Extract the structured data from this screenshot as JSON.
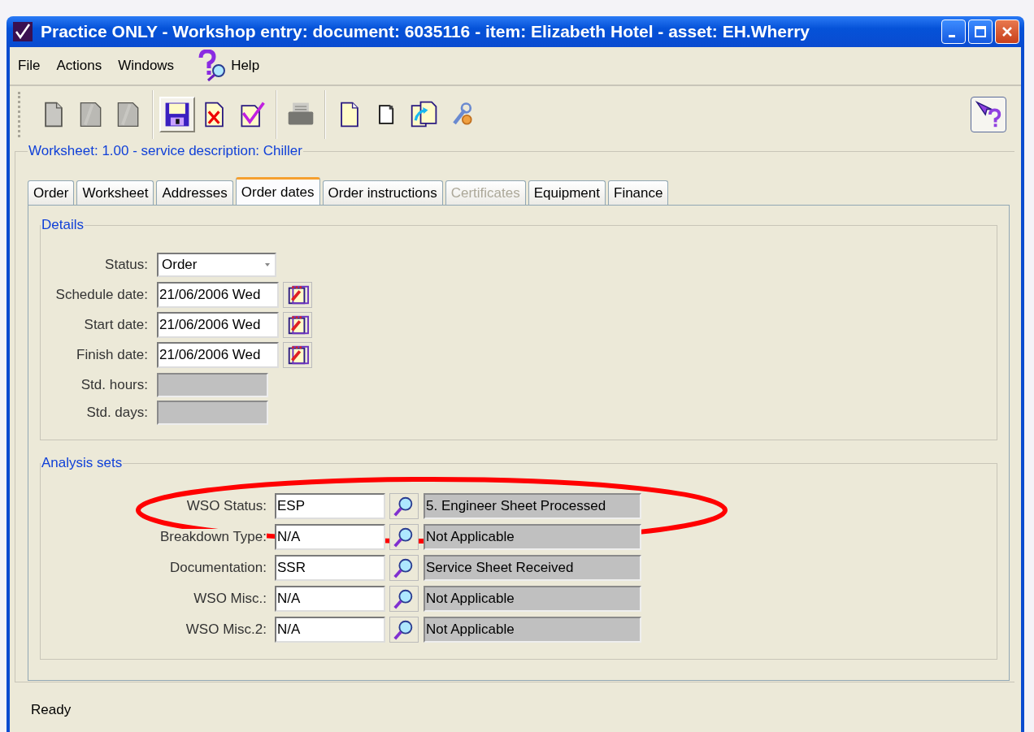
{
  "window": {
    "title": "Practice ONLY - Workshop entry: document: 6035116 - item: Elizabeth Hotel - asset: EH.Wherry"
  },
  "menu": [
    {
      "label": "File",
      "kind": "text"
    },
    {
      "label": "Actions",
      "kind": "text"
    },
    {
      "label": "Windows",
      "kind": "text"
    },
    {
      "label": "Help",
      "kind": "help"
    }
  ],
  "toolbar": [
    {
      "kind": "page",
      "disabled": true,
      "pressed": false
    },
    {
      "kind": "pages",
      "disabled": true,
      "pressed": false
    },
    {
      "kind": "pages",
      "disabled": true,
      "pressed": false
    },
    {
      "kind": "separator"
    },
    {
      "kind": "save",
      "disabled": false,
      "pressed": true
    },
    {
      "kind": "delete",
      "disabled": false,
      "pressed": false
    },
    {
      "kind": "approve",
      "disabled": false,
      "pressed": false
    },
    {
      "kind": "separator"
    },
    {
      "kind": "print",
      "disabled": true,
      "pressed": false
    },
    {
      "kind": "separator"
    },
    {
      "kind": "page",
      "disabled": false,
      "pressed": false
    },
    {
      "kind": "small-page",
      "disabled": false,
      "pressed": false
    },
    {
      "kind": "copy",
      "disabled": false,
      "pressed": false
    },
    {
      "kind": "tools",
      "disabled": false,
      "pressed": false
    }
  ],
  "worksheet_group": {
    "title": "Worksheet: 1.00 - service description: Chiller"
  },
  "tabs": [
    {
      "label": "Order",
      "selected": false,
      "disabled": false
    },
    {
      "label": "Worksheet",
      "selected": false,
      "disabled": false
    },
    {
      "label": "Addresses",
      "selected": false,
      "disabled": false
    },
    {
      "label": "Order dates",
      "selected": true,
      "disabled": false
    },
    {
      "label": "Order instructions",
      "selected": false,
      "disabled": false
    },
    {
      "label": "Certificates",
      "selected": false,
      "disabled": true
    },
    {
      "label": "Equipment",
      "selected": false,
      "disabled": false
    },
    {
      "label": "Finance",
      "selected": false,
      "disabled": false
    }
  ],
  "details": {
    "title": "Details",
    "fields": [
      {
        "label": "Status:",
        "kind": "combo",
        "value": "Order"
      },
      {
        "label": "Schedule date:",
        "kind": "date",
        "value": "21/06/2006 Wed"
      },
      {
        "label": "Start date:",
        "kind": "date",
        "value": "21/06/2006 Wed"
      },
      {
        "label": "Finish date:",
        "kind": "date",
        "value": "21/06/2006 Wed"
      },
      {
        "label": "Std. hours:",
        "kind": "readonly"
      },
      {
        "label": "Std. days:",
        "kind": "readonly"
      }
    ]
  },
  "analysis_sets": {
    "title": "Analysis sets",
    "rows": [
      {
        "label": "WSO Status:",
        "code": "ESP",
        "description": "5. Engineer Sheet Processed"
      },
      {
        "label": "Breakdown Type:",
        "code": "N/A",
        "description": "Not Applicable"
      },
      {
        "label": "Documentation:",
        "code": "SSR",
        "description": "Service Sheet Received"
      },
      {
        "label": "WSO Misc.:",
        "code": "N/A",
        "description": "Not Applicable"
      },
      {
        "label": "WSO Misc.2:",
        "code": "N/A",
        "description": "Not Applicable"
      }
    ]
  },
  "annotation": {
    "color": "#ff0000"
  },
  "status_bar": "Ready"
}
